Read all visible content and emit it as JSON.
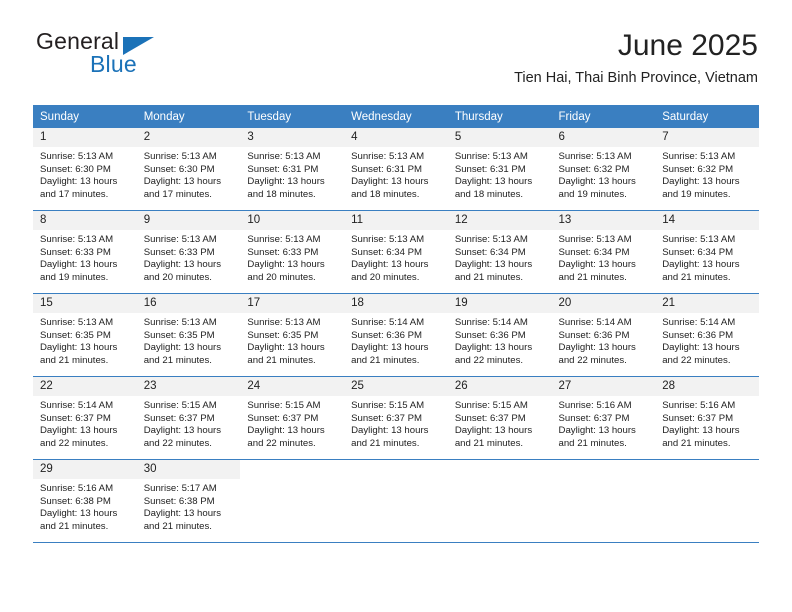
{
  "brand": {
    "name_top": "General",
    "name_bottom": "Blue",
    "triangle_icon": "triangle-icon",
    "accent_color": "#1b72b8"
  },
  "header": {
    "title": "June 2025",
    "subtitle": "Tien Hai, Thai Binh Province, Vietnam"
  },
  "theme": {
    "header_blue": "#3a7fc1",
    "daynum_gray": "#f2f2f2",
    "text": "#222222"
  },
  "calendar": {
    "weekday_headers": [
      "Sunday",
      "Monday",
      "Tuesday",
      "Wednesday",
      "Thursday",
      "Friday",
      "Saturday"
    ],
    "weeks": [
      [
        {
          "day": "1",
          "sunrise": "Sunrise: 5:13 AM",
          "sunset": "Sunset: 6:30 PM",
          "daylight_line1": "Daylight: 13 hours",
          "daylight_line2": "and 17 minutes."
        },
        {
          "day": "2",
          "sunrise": "Sunrise: 5:13 AM",
          "sunset": "Sunset: 6:30 PM",
          "daylight_line1": "Daylight: 13 hours",
          "daylight_line2": "and 17 minutes."
        },
        {
          "day": "3",
          "sunrise": "Sunrise: 5:13 AM",
          "sunset": "Sunset: 6:31 PM",
          "daylight_line1": "Daylight: 13 hours",
          "daylight_line2": "and 18 minutes."
        },
        {
          "day": "4",
          "sunrise": "Sunrise: 5:13 AM",
          "sunset": "Sunset: 6:31 PM",
          "daylight_line1": "Daylight: 13 hours",
          "daylight_line2": "and 18 minutes."
        },
        {
          "day": "5",
          "sunrise": "Sunrise: 5:13 AM",
          "sunset": "Sunset: 6:31 PM",
          "daylight_line1": "Daylight: 13 hours",
          "daylight_line2": "and 18 minutes."
        },
        {
          "day": "6",
          "sunrise": "Sunrise: 5:13 AM",
          "sunset": "Sunset: 6:32 PM",
          "daylight_line1": "Daylight: 13 hours",
          "daylight_line2": "and 19 minutes."
        },
        {
          "day": "7",
          "sunrise": "Sunrise: 5:13 AM",
          "sunset": "Sunset: 6:32 PM",
          "daylight_line1": "Daylight: 13 hours",
          "daylight_line2": "and 19 minutes."
        }
      ],
      [
        {
          "day": "8",
          "sunrise": "Sunrise: 5:13 AM",
          "sunset": "Sunset: 6:33 PM",
          "daylight_line1": "Daylight: 13 hours",
          "daylight_line2": "and 19 minutes."
        },
        {
          "day": "9",
          "sunrise": "Sunrise: 5:13 AM",
          "sunset": "Sunset: 6:33 PM",
          "daylight_line1": "Daylight: 13 hours",
          "daylight_line2": "and 20 minutes."
        },
        {
          "day": "10",
          "sunrise": "Sunrise: 5:13 AM",
          "sunset": "Sunset: 6:33 PM",
          "daylight_line1": "Daylight: 13 hours",
          "daylight_line2": "and 20 minutes."
        },
        {
          "day": "11",
          "sunrise": "Sunrise: 5:13 AM",
          "sunset": "Sunset: 6:34 PM",
          "daylight_line1": "Daylight: 13 hours",
          "daylight_line2": "and 20 minutes."
        },
        {
          "day": "12",
          "sunrise": "Sunrise: 5:13 AM",
          "sunset": "Sunset: 6:34 PM",
          "daylight_line1": "Daylight: 13 hours",
          "daylight_line2": "and 21 minutes."
        },
        {
          "day": "13",
          "sunrise": "Sunrise: 5:13 AM",
          "sunset": "Sunset: 6:34 PM",
          "daylight_line1": "Daylight: 13 hours",
          "daylight_line2": "and 21 minutes."
        },
        {
          "day": "14",
          "sunrise": "Sunrise: 5:13 AM",
          "sunset": "Sunset: 6:34 PM",
          "daylight_line1": "Daylight: 13 hours",
          "daylight_line2": "and 21 minutes."
        }
      ],
      [
        {
          "day": "15",
          "sunrise": "Sunrise: 5:13 AM",
          "sunset": "Sunset: 6:35 PM",
          "daylight_line1": "Daylight: 13 hours",
          "daylight_line2": "and 21 minutes."
        },
        {
          "day": "16",
          "sunrise": "Sunrise: 5:13 AM",
          "sunset": "Sunset: 6:35 PM",
          "daylight_line1": "Daylight: 13 hours",
          "daylight_line2": "and 21 minutes."
        },
        {
          "day": "17",
          "sunrise": "Sunrise: 5:13 AM",
          "sunset": "Sunset: 6:35 PM",
          "daylight_line1": "Daylight: 13 hours",
          "daylight_line2": "and 21 minutes."
        },
        {
          "day": "18",
          "sunrise": "Sunrise: 5:14 AM",
          "sunset": "Sunset: 6:36 PM",
          "daylight_line1": "Daylight: 13 hours",
          "daylight_line2": "and 21 minutes."
        },
        {
          "day": "19",
          "sunrise": "Sunrise: 5:14 AM",
          "sunset": "Sunset: 6:36 PM",
          "daylight_line1": "Daylight: 13 hours",
          "daylight_line2": "and 22 minutes."
        },
        {
          "day": "20",
          "sunrise": "Sunrise: 5:14 AM",
          "sunset": "Sunset: 6:36 PM",
          "daylight_line1": "Daylight: 13 hours",
          "daylight_line2": "and 22 minutes."
        },
        {
          "day": "21",
          "sunrise": "Sunrise: 5:14 AM",
          "sunset": "Sunset: 6:36 PM",
          "daylight_line1": "Daylight: 13 hours",
          "daylight_line2": "and 22 minutes."
        }
      ],
      [
        {
          "day": "22",
          "sunrise": "Sunrise: 5:14 AM",
          "sunset": "Sunset: 6:37 PM",
          "daylight_line1": "Daylight: 13 hours",
          "daylight_line2": "and 22 minutes."
        },
        {
          "day": "23",
          "sunrise": "Sunrise: 5:15 AM",
          "sunset": "Sunset: 6:37 PM",
          "daylight_line1": "Daylight: 13 hours",
          "daylight_line2": "and 22 minutes."
        },
        {
          "day": "24",
          "sunrise": "Sunrise: 5:15 AM",
          "sunset": "Sunset: 6:37 PM",
          "daylight_line1": "Daylight: 13 hours",
          "daylight_line2": "and 22 minutes."
        },
        {
          "day": "25",
          "sunrise": "Sunrise: 5:15 AM",
          "sunset": "Sunset: 6:37 PM",
          "daylight_line1": "Daylight: 13 hours",
          "daylight_line2": "and 21 minutes."
        },
        {
          "day": "26",
          "sunrise": "Sunrise: 5:15 AM",
          "sunset": "Sunset: 6:37 PM",
          "daylight_line1": "Daylight: 13 hours",
          "daylight_line2": "and 21 minutes."
        },
        {
          "day": "27",
          "sunrise": "Sunrise: 5:16 AM",
          "sunset": "Sunset: 6:37 PM",
          "daylight_line1": "Daylight: 13 hours",
          "daylight_line2": "and 21 minutes."
        },
        {
          "day": "28",
          "sunrise": "Sunrise: 5:16 AM",
          "sunset": "Sunset: 6:37 PM",
          "daylight_line1": "Daylight: 13 hours",
          "daylight_line2": "and 21 minutes."
        }
      ],
      [
        {
          "day": "29",
          "sunrise": "Sunrise: 5:16 AM",
          "sunset": "Sunset: 6:38 PM",
          "daylight_line1": "Daylight: 13 hours",
          "daylight_line2": "and 21 minutes."
        },
        {
          "day": "30",
          "sunrise": "Sunrise: 5:17 AM",
          "sunset": "Sunset: 6:38 PM",
          "daylight_line1": "Daylight: 13 hours",
          "daylight_line2": "and 21 minutes."
        },
        {
          "day": "",
          "sunrise": "",
          "sunset": "",
          "daylight_line1": "",
          "daylight_line2": ""
        },
        {
          "day": "",
          "sunrise": "",
          "sunset": "",
          "daylight_line1": "",
          "daylight_line2": ""
        },
        {
          "day": "",
          "sunrise": "",
          "sunset": "",
          "daylight_line1": "",
          "daylight_line2": ""
        },
        {
          "day": "",
          "sunrise": "",
          "sunset": "",
          "daylight_line1": "",
          "daylight_line2": ""
        },
        {
          "day": "",
          "sunrise": "",
          "sunset": "",
          "daylight_line1": "",
          "daylight_line2": ""
        }
      ]
    ]
  }
}
